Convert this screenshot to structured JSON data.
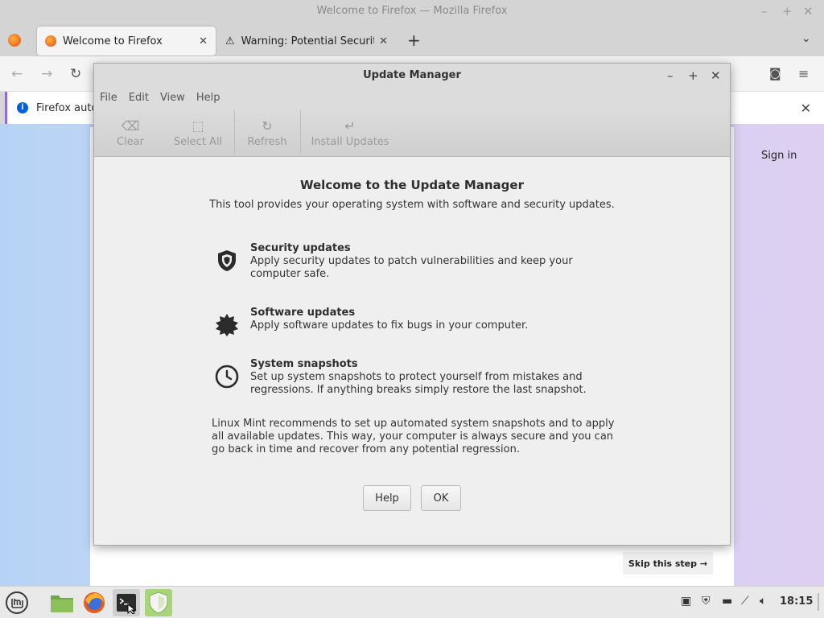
{
  "firefox": {
    "window_title": "Welcome to Firefox — Mozilla Firefox",
    "tabs": [
      {
        "label": "Welcome to Firefox"
      },
      {
        "label": "Warning: Potential Security"
      }
    ],
    "notification": "Firefox auto",
    "sign_in": "Sign in",
    "skip_step": "Skip this step →"
  },
  "update_manager": {
    "title": "Update Manager",
    "menu": [
      "File",
      "Edit",
      "View",
      "Help"
    ],
    "toolbar": {
      "clear": "Clear",
      "select_all": "Select All",
      "refresh": "Refresh",
      "install_updates": "Install Updates"
    },
    "welcome_title": "Welcome to the Update Manager",
    "welcome_subtitle": "This tool provides your operating system with software and security updates.",
    "features": [
      {
        "title": "Security updates",
        "desc": "Apply security updates to patch vulnerabilities and keep your computer safe.",
        "icon": "shield-icon"
      },
      {
        "title": "Software updates",
        "desc": "Apply software updates to fix bugs in your computer.",
        "icon": "gear-badge-icon"
      },
      {
        "title": "System snapshots",
        "desc": "Set up system snapshots to protect yourself from mistakes and regressions. If anything breaks simply restore the last snapshot.",
        "icon": "clock-icon"
      }
    ],
    "recommendation": "Linux Mint recommends to set up automated system snapshots and to apply all available updates. This way, your computer is always secure and you can go back in time and recover from any potential regression.",
    "buttons": {
      "help": "Help",
      "ok": "OK"
    }
  },
  "taskbar": {
    "clock": "18:15",
    "apps": [
      "mint-menu-icon",
      "files-icon",
      "firefox-icon",
      "terminal-icon",
      "update-manager-icon"
    ]
  }
}
